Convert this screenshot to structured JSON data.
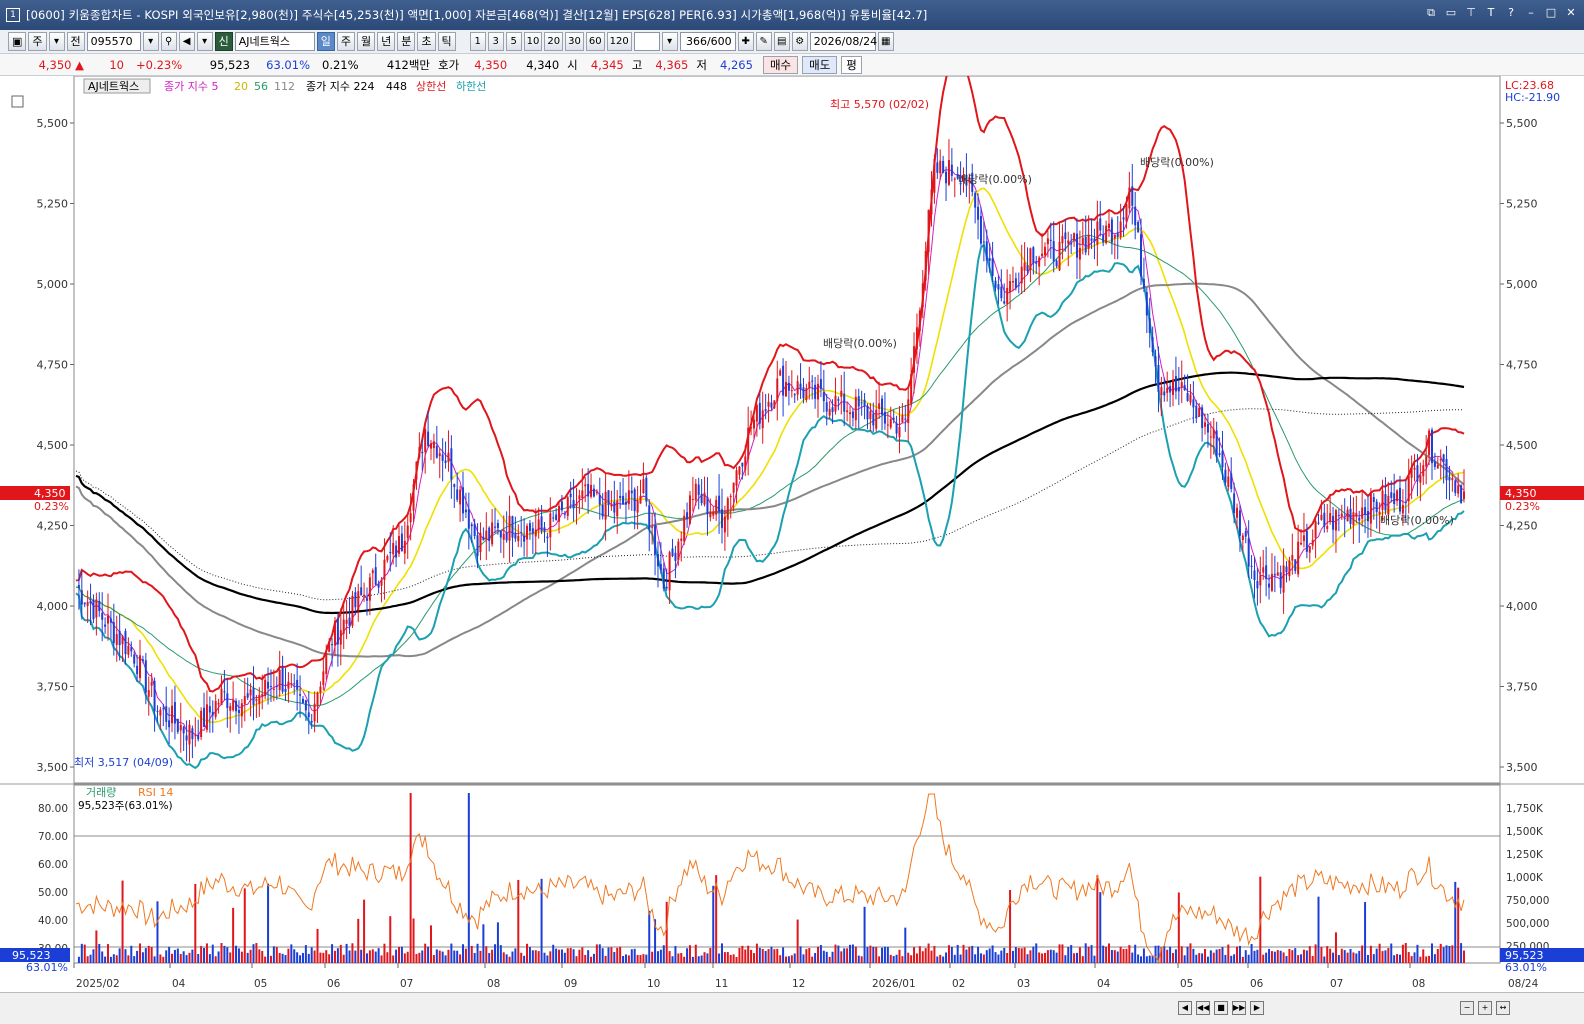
{
  "titlebar": {
    "window_num": "1",
    "title": "[0600] 키움종합차트 - KOSPI 외국인보유[2,980(천)] 주식수[45,253(천)] 액면[1,000] 자본금[468(억)] 결산[12월] EPS[628] PER[6.93] 시가총액[1,968(억)] 유통비율[42.7]"
  },
  "toolbar": {
    "type_label": "주",
    "full_label": "전",
    "code": "095570",
    "trust_label": "신",
    "stock_name": "AJ네트웍스",
    "periods": [
      "일",
      "주",
      "월",
      "년",
      "분",
      "초",
      "틱"
    ],
    "active_period": "일",
    "intervals": [
      "1",
      "3",
      "5",
      "10",
      "20",
      "30",
      "60",
      "120"
    ],
    "count": "366/600",
    "date": "2026/08/24"
  },
  "quote": {
    "price": "4,350",
    "change": "10",
    "change_pct": "+0.23%",
    "volume": "95,523",
    "vol_ratio": "63.01%",
    "turnover": "0.21%",
    "amount": "412백만",
    "ask_label": "호가",
    "ask": "4,350",
    "bid": "4,340",
    "open_label": "시",
    "open": "4,345",
    "high_label": "고",
    "high": "4,365",
    "low_label": "저",
    "low": "4,265",
    "buy_label": "매수",
    "sell_label": "매도",
    "avg_label": "평"
  },
  "legend": {
    "stock": "AJ네트웍스",
    "ma_short_label": "종가 지수 5",
    "ma20": "20",
    "ma56": "56",
    "ma112": "112",
    "ma_long_label": "종가 지수 224",
    "ma448": "448",
    "upper_label": "상한선",
    "lower_label": "하한선",
    "lc": "LC:23.68",
    "hc": "HC:-21.90"
  },
  "annotations": {
    "high": "최고 5,570 (02/02)",
    "low": "최저 3,517 (04/09)",
    "div1": "배당락(0.00%)",
    "div2": "배당락(0.00%)",
    "div3": "배당락(0.00%)",
    "div4": "배당락(0.00%)",
    "price_tag": "4,350",
    "price_tag_pct": "0.23%"
  },
  "sub": {
    "volume_label": "거래량",
    "rsi_label": "RSI 14",
    "vol_info": "95,523주(63.01%)",
    "vol_tag": "95,523",
    "vol_tag_pct": "63.01%"
  },
  "axes": {
    "price_ticks": [
      "5,500",
      "5,250",
      "5,000",
      "4,750",
      "4,500",
      "4,250",
      "4,000",
      "3,750",
      "3,500"
    ],
    "rsi_ticks": [
      "80.00",
      "70.00",
      "60.00",
      "50.00",
      "40.00",
      "30.00"
    ],
    "vol_ticks": [
      "1,750K",
      "1,500K",
      "1,250K",
      "1,000K",
      "750,000",
      "500,000",
      "250,000"
    ],
    "months": [
      "2025/02",
      "04",
      "05",
      "06",
      "07",
      "08",
      "09",
      "10",
      "11",
      "12",
      "2026/01",
      "02",
      "03",
      "04",
      "05",
      "06",
      "07",
      "08"
    ],
    "last_date": "08/24"
  },
  "colors": {
    "up": "#e0161b",
    "down": "#1b3fd6",
    "ma5": "#d020c0",
    "ma20": "#f0e000",
    "ma56": "#2a9a6a",
    "ma112": "#888888",
    "ma224": "#000000",
    "upper": "#e0161b",
    "lower": "#1aa0b0",
    "rsi": "#f07820"
  }
}
